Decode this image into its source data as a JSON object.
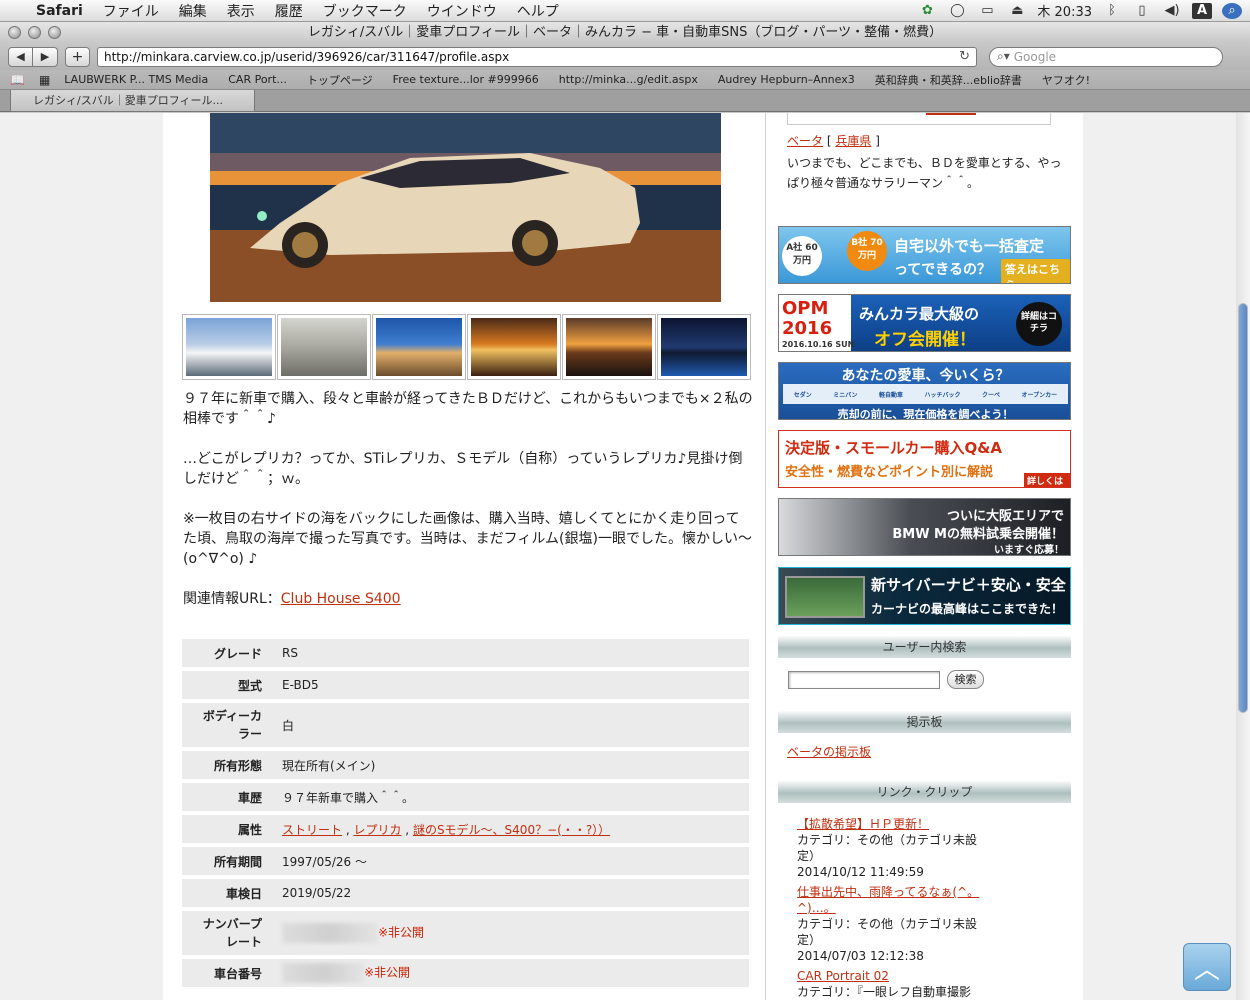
{
  "menubar": {
    "app": "Safari",
    "items": [
      "ファイル",
      "編集",
      "表示",
      "履歴",
      "ブックマーク",
      "ウインドウ",
      "ヘルプ"
    ],
    "clock": "木 20:33"
  },
  "window": {
    "title": "レガシィ/スバル｜愛車プロフィール｜ベータ｜みんカラ − 車・自動車SNS（ブログ・パーツ・整備・燃費）"
  },
  "toolbar": {
    "url": "http://minkara.carview.co.jp/userid/396926/car/311647/profile.aspx",
    "search_placeholder": "Google"
  },
  "bookmarks": [
    "LAUBWERK P... TMS Media",
    "CAR Port...",
    "トップページ",
    "Free texture...lor #999966",
    "http://minka...g/edit.aspx",
    "Audrey Hepburn–Annex3",
    "英和辞典・和英辞...eblio辞書",
    "ヤフオク!"
  ],
  "tab": {
    "title": "レガシィ/スバル｜愛車プロフィール..."
  },
  "description": {
    "p1": "９７年に新車で購入、段々と車齢が経ってきたＢＤだけど、これからもいつまでも×２私の相棒です＾＾♪",
    "p2": "…どこがレプリカ？ってか、STiレプリカ、Ｓモデル（自称）っていうレプリカ♪見掛け倒しだけど＾＾；ｗ。",
    "p3": "※一枚目の右サイドの海をバックにした画像は、購入当時、嬉しくてとにかく走り回ってた頃、鳥取の海岸で撮った写真です。当時は、まだフィルム(銀塩)一眼でした。懐かしい〜(o^∇^o) ♪",
    "url_label": "関連情報URL：",
    "url_link": "Club House S400"
  },
  "specs": {
    "grade_k": "グレード",
    "grade_v": "RS",
    "model_k": "型式",
    "model_v": "E-BD5",
    "color_k": "ボディーカラー",
    "color_v": "白",
    "own_k": "所有形態",
    "own_v": "現在所有(メイン)",
    "hist_k": "車歴",
    "hist_v": "９７年新車で購入＾＾。",
    "attr_k": "属性",
    "attr_1": "ストリート",
    "attr_2": "レプリカ",
    "attr_3": "謎のSモデル〜、S400？−(・・?））",
    "sep": " , ",
    "period_k": "所有期間",
    "period_v": "1997/05/26 〜",
    "inspect_k": "車検日",
    "inspect_v": "2019/05/22",
    "plate_k": "ナンバープレート",
    "plate_v": "※非公開",
    "chassis_k": "車台番号",
    "chassis_v": "※非公開"
  },
  "profile": {
    "name": "ベータ",
    "bracket_open": "[",
    "location": "兵庫県",
    "bracket_close": "]",
    "bio": "いつまでも、どこまでも、ＢＤを愛車とする、やっぱり極々普通なサラリーマン＾＾。"
  },
  "banners": {
    "b1_a": "A社 60万円",
    "b1_b": "B社 70万円",
    "b1_line1": "自宅以外でも一括査定",
    "b1_line2": "ってできるの？",
    "b1_btn": "答えはこちら",
    "b2_big": "OPM 2016",
    "b2_date": "2016.10.16 SUN",
    "b2_line1": "みんカラ最大級の",
    "b2_line2": "オフ会開催！",
    "b2_btn": "詳細はコチラ",
    "b3_title": "あなたの愛車、今いくら？",
    "b3_types": [
      "セダン",
      "ミニバン",
      "軽自動車",
      "ハッチバック",
      "クーペ",
      "オープンカー"
    ],
    "b3_foot": "売却の前に、現在価格を調べよう！",
    "b4_line1": "決定版・スモールカー購入Q&A",
    "b4_line2": "安全性・燃費などポイント別に解説",
    "b4_btn": "詳しくは▶",
    "b5_line1": "ついに大阪エリアで",
    "b5_line2": "BMW Mの無料試乗会開催！",
    "b5_btn": "いますぐ応募！",
    "b6_line1": "新サイバーナビ＋安心・安全",
    "b6_line2": "カーナビの最高峰はここまできた！"
  },
  "search": {
    "header": "ユーザー内検索",
    "button": "検索",
    "value": ""
  },
  "board": {
    "header": "掲示板",
    "link": "ベータの掲示板"
  },
  "clips": {
    "header": "リンク・クリップ",
    "items": [
      {
        "title": "【拡散希望】ＨＰ更新！",
        "cat": "カテゴリ：その他（カテゴリ未設定）",
        "date": "2014/10/12 11:49:59"
      },
      {
        "title": "仕事出先中、雨降ってるなぁ(^。^)…。",
        "cat": "カテゴリ：その他（カテゴリ未設定）",
        "date": "2014/07/03 12:12:38"
      },
      {
        "title": "CAR Portrait 02",
        "cat": "カテゴリ：『一眼レフ自動車撮影"
      }
    ]
  },
  "colors": {
    "link": "#c03010",
    "accent_blue": "#1a5aa0",
    "scroll": "#5b86c4"
  }
}
